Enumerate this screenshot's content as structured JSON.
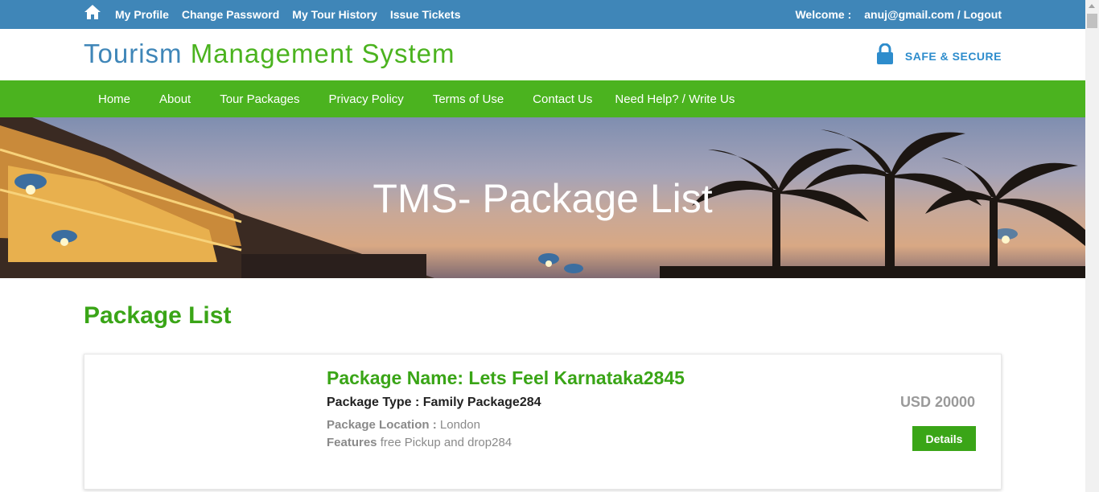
{
  "topbar": {
    "links": [
      "My Profile",
      "Change Password",
      "My Tour History",
      "Issue Tickets"
    ],
    "welcome_label": "Welcome :",
    "user_logout": "anuj@gmail.com / Logout"
  },
  "header": {
    "brand_part1": "Tourism ",
    "brand_part2": "Management System",
    "secure_text": "SAFE & SECURE"
  },
  "nav": {
    "items": [
      "Home",
      "About",
      "Tour Packages",
      "Privacy Policy",
      "Terms of Use",
      "Contact Us"
    ],
    "help": "Need Help?  / Write Us"
  },
  "banner": {
    "title": "TMS- Package List"
  },
  "main": {
    "section_title": "Package List",
    "packages": [
      {
        "name": "Package Name: Lets Feel Karnataka2845",
        "type": "Package Type : Family Package284",
        "location_label": "Package Location :",
        "location": " London",
        "features_label": "Features",
        "features": " free Pickup and drop284",
        "price": "USD 20000",
        "details_label": "Details"
      }
    ]
  },
  "colors": {
    "topbar": "#3f86b8",
    "brand_green": "#4bb31f",
    "nav_green": "#4bb31f",
    "title_green": "#3aa517",
    "secure_blue": "#2d8ccc"
  }
}
